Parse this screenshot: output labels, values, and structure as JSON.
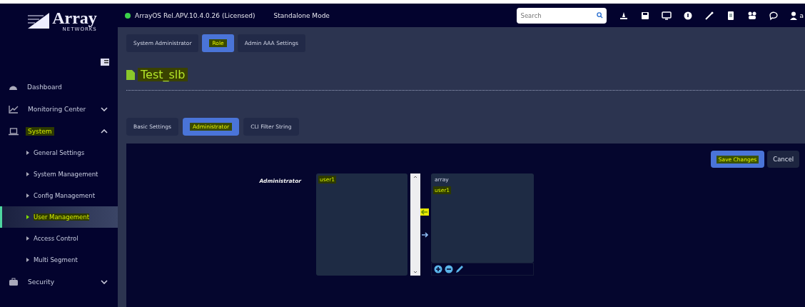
{
  "logo": {
    "name": "Array",
    "tagline": "NETWORKS"
  },
  "header": {
    "status_online": true,
    "version": "ArrayOS Rel.APV.10.4.0.26 (Licensed)",
    "mode": "Standalone Mode",
    "search": {
      "placeholder": "Search"
    },
    "user": "a"
  },
  "sidebar": {
    "items": [
      {
        "label": "Dashboard",
        "highlighted": false
      },
      {
        "label": "Monitoring Center",
        "highlighted": false,
        "expanded": false
      },
      {
        "label": "System",
        "highlighted": true,
        "expanded": true,
        "children": [
          {
            "label": "General Settings",
            "selected": false,
            "highlighted": false
          },
          {
            "label": "System Management",
            "selected": false,
            "highlighted": false
          },
          {
            "label": "Config Management",
            "selected": false,
            "highlighted": false
          },
          {
            "label": "User Management",
            "selected": true,
            "highlighted": true
          },
          {
            "label": "Access Control",
            "selected": false,
            "highlighted": false
          },
          {
            "label": "Multi Segment",
            "selected": false,
            "highlighted": false
          }
        ]
      },
      {
        "label": "Security",
        "highlighted": false,
        "expanded": false
      }
    ]
  },
  "tabs": [
    {
      "label": "System Administrator",
      "selected": false,
      "highlighted": false
    },
    {
      "label": "Role",
      "selected": true,
      "highlighted": true
    },
    {
      "label": "Admin AAA Settings",
      "selected": false,
      "highlighted": false
    }
  ],
  "title": {
    "text": "Test_slb",
    "highlighted": true
  },
  "subtabs": [
    {
      "label": "Basic Settings",
      "selected": false,
      "highlighted": false
    },
    {
      "label": "Administrator",
      "selected": true,
      "highlighted": true
    },
    {
      "label": "CLI Filter String",
      "selected": false,
      "highlighted": false
    }
  ],
  "buttons": [
    {
      "label": "Save Changes",
      "kind": "primary",
      "highlighted": true
    },
    {
      "label": "Cancel",
      "kind": "secondary",
      "highlighted": false
    }
  ],
  "field": {
    "label": "Administrator",
    "available": [
      {
        "text": "user1",
        "highlighted": true
      }
    ],
    "assigned": [
      {
        "text": "array",
        "highlighted": false
      },
      {
        "text": "user1",
        "highlighted": true
      }
    ],
    "move_left_highlighted": true
  }
}
